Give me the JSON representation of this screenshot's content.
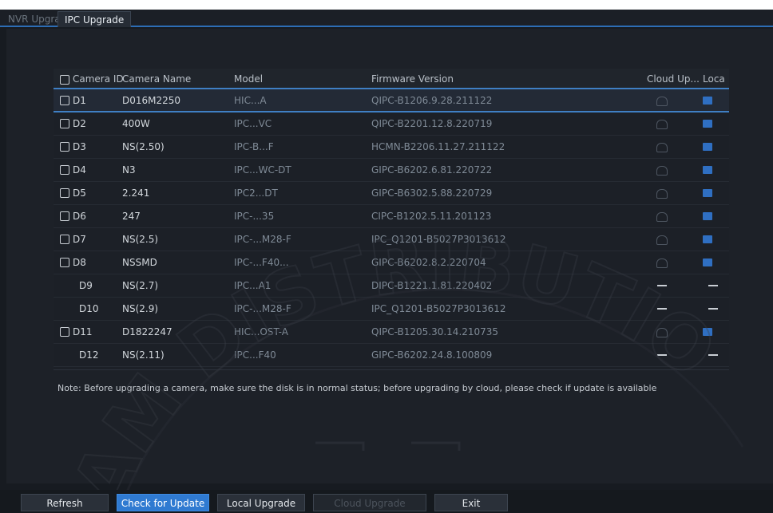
{
  "tabs": [
    {
      "label": "NVR Upgrade"
    },
    {
      "label": "IPC Upgrade"
    }
  ],
  "table": {
    "headers": {
      "camera_id": "Camera ID",
      "camera_name": "Camera Name",
      "model": "Model",
      "firmware": "Firmware Version",
      "cloud": "Cloud Up...",
      "local": "Loca"
    },
    "rows": [
      {
        "id": "D1",
        "name": "D016M2250",
        "model": "HIC...A",
        "firmware": "QIPC-B1206.9.28.211122",
        "checkbox": true,
        "available": true,
        "selected": true
      },
      {
        "id": "D2",
        "name": "400W",
        "model": "IPC...VC",
        "firmware": "QIPC-B2201.12.8.220719",
        "checkbox": true,
        "available": true
      },
      {
        "id": "D3",
        "name": "NS(2.50)",
        "model": "IPC-B...F",
        "firmware": "HCMN-B2206.11.27.211122",
        "checkbox": true,
        "available": true
      },
      {
        "id": "D4",
        "name": "N3",
        "model": "IPC...WC-DT",
        "firmware": "GIPC-B6202.6.81.220722",
        "checkbox": true,
        "available": true
      },
      {
        "id": "D5",
        "name": "2.241",
        "model": "IPC2...DT",
        "firmware": "GIPC-B6302.5.88.220729",
        "checkbox": true,
        "available": true
      },
      {
        "id": "D6",
        "name": "247",
        "model": "IPC-...35",
        "firmware": "CIPC-B1202.5.11.201123",
        "checkbox": true,
        "available": true
      },
      {
        "id": "D7",
        "name": "NS(2.5)",
        "model": "IPC-...M28-F",
        "firmware": "IPC_Q1201-B5027P3013612",
        "checkbox": true,
        "available": true
      },
      {
        "id": "D8",
        "name": "NSSMD",
        "model": "IPC-...F40...",
        "firmware": "GIPC-B6202.8.2.220704",
        "checkbox": true,
        "available": true
      },
      {
        "id": "D9",
        "name": "NS(2.7)",
        "model": "IPC...A1",
        "firmware": "DIPC-B1221.1.81.220402",
        "checkbox": false,
        "available": false
      },
      {
        "id": "D10",
        "name": "NS(2.9)",
        "model": "IPC-...M28-F",
        "firmware": "IPC_Q1201-B5027P3013612",
        "checkbox": false,
        "available": false
      },
      {
        "id": "D11",
        "name": "D1822247",
        "model": "HIC...OST-A",
        "firmware": "QIPC-B1205.30.14.210735",
        "checkbox": true,
        "available": true
      },
      {
        "id": "D12",
        "name": "NS(2.11)",
        "model": "IPC...F40",
        "firmware": "GIPC-B6202.24.8.100809",
        "checkbox": false,
        "available": false
      }
    ]
  },
  "note": "Note: Before upgrading a camera, make sure the disk is in normal status; before upgrading by cloud, please check if update is available",
  "buttons": {
    "refresh": "Refresh",
    "check_update": "Check for Update",
    "local_upgrade": "Local Upgrade",
    "cloud_upgrade": "Cloud Upgrade",
    "exit": "Exit"
  },
  "watermark": "AM DISTRIBUTIO",
  "colors": {
    "accent": "#2f7ad1",
    "background": "#171b21",
    "selection_line": "#3f7fc4"
  }
}
